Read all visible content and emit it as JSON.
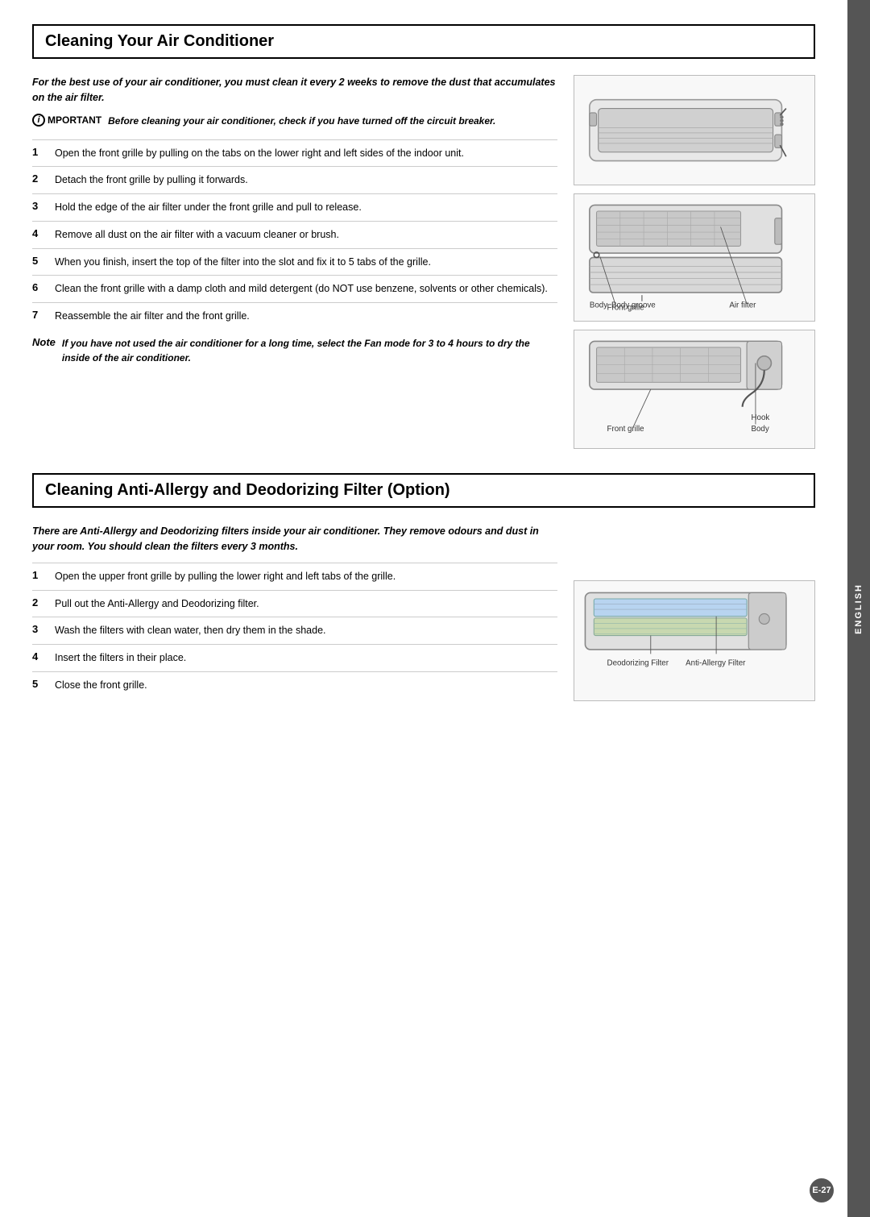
{
  "page": {
    "side_tab": "ENGLISH",
    "page_number": "E-27",
    "section1": {
      "title": "Cleaning Your Air Conditioner",
      "intro": "For the best use of your air conditioner, you must clean it every 2 weeks to remove the dust that accumulates on the air filter.",
      "important_label": "PORTANT",
      "important_text": "Before cleaning your air conditioner, check if you have turned off the circuit breaker.",
      "steps": [
        {
          "num": "1",
          "text": "Open the front grille by pulling on the tabs on the lower right and left sides of the indoor unit."
        },
        {
          "num": "2",
          "text": "Detach the front grille by pulling it forwards."
        },
        {
          "num": "3",
          "text": "Hold the edge of the air filter under the front grille and pull to release."
        },
        {
          "num": "4",
          "text": "Remove all dust on the air filter with a vacuum cleaner or brush."
        },
        {
          "num": "5",
          "text": "When you finish, insert the top of the filter into the slot and fix it to 5 tabs of the grille."
        },
        {
          "num": "6",
          "text": "Clean the front grille with a damp cloth and mild detergent (do NOT use benzene, solvents or other chemicals)."
        },
        {
          "num": "7",
          "text": "Reassemble the air filter and the front grille."
        }
      ],
      "note_label": "Note",
      "note_text": "If you have not used the air conditioner for a long time, select the Fan mode for 3 to 4 hours to dry the inside of the air conditioner.",
      "diagrams": [
        {
          "id": "diagram1",
          "labels": []
        },
        {
          "id": "diagram2",
          "labels": [
            "Front grille",
            "Body groove",
            "Air filter",
            "Body"
          ]
        },
        {
          "id": "diagram3",
          "labels": [
            "Body",
            "Hook",
            "Front grille"
          ]
        }
      ]
    },
    "section2": {
      "title": "Cleaning Anti-Allergy and Deodorizing Filter (Option)",
      "intro": "There are Anti-Allergy and Deodorizing filters inside your air conditioner. They remove odours and dust in your room. You should clean the filters every 3 months.",
      "steps": [
        {
          "num": "1",
          "text": "Open the upper front grille by pulling the lower right and left tabs of the grille."
        },
        {
          "num": "2",
          "text": "Pull out the Anti-Allergy and Deodorizing filter."
        },
        {
          "num": "3",
          "text": "Wash the filters with clean water, then dry them in the shade."
        },
        {
          "num": "4",
          "text": "Insert the filters in their place."
        },
        {
          "num": "5",
          "text": "Close the front grille."
        }
      ],
      "diagram_labels": [
        "Deodorizing Filter",
        "Anti-Allergy Filter"
      ]
    }
  }
}
